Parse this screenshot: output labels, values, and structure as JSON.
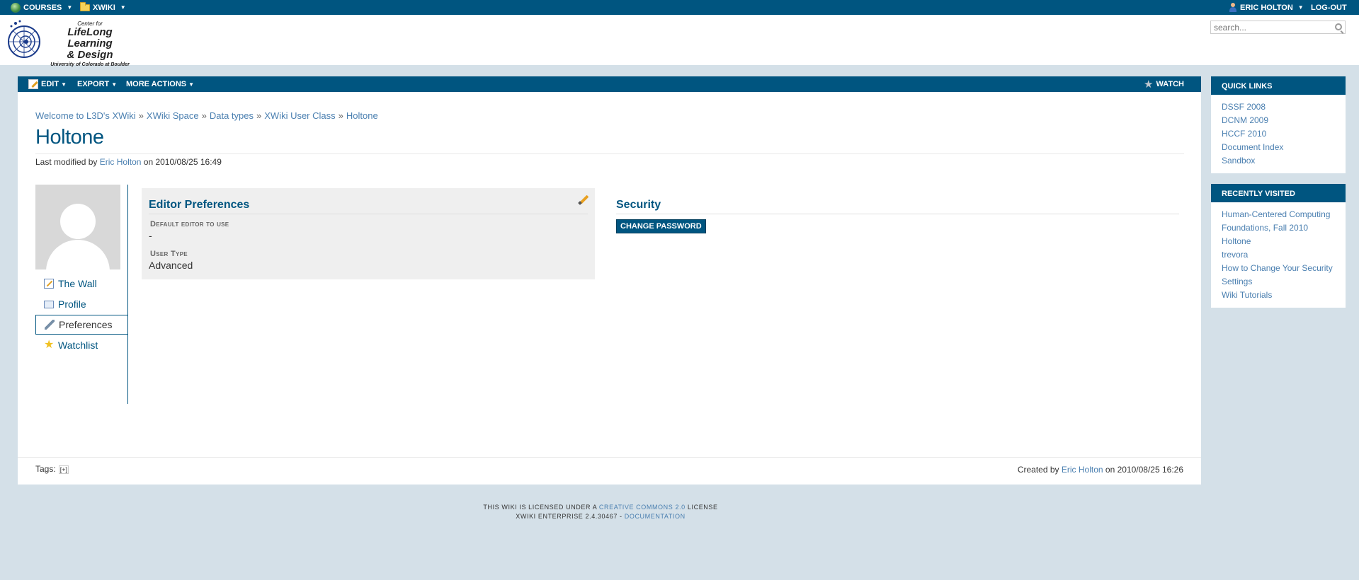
{
  "topbar": {
    "courses": "COURSES",
    "xwiki": "XWIKI",
    "user": "ERIC HOLTON",
    "logout": "LOG-OUT"
  },
  "logo": {
    "center": "Center for",
    "line1": "LifeLong Learning",
    "line2": "& Design",
    "univ": "University of Colorado at Boulder"
  },
  "search": {
    "placeholder": "search..."
  },
  "menubar": {
    "edit": "EDIT",
    "export": "EXPORT",
    "more_actions": "MORE ACTIONS",
    "watch": "WATCH"
  },
  "breadcrumb": [
    "Welcome to L3D's XWiki",
    "XWiki Space",
    "Data types",
    "XWiki User Class",
    "Holtone"
  ],
  "page": {
    "title": "Holtone",
    "last_modified_prefix": "Last modified by",
    "last_modified_user": "Eric Holton",
    "last_modified_suffix": "on 2010/08/25 16:49"
  },
  "profile_menu": {
    "wall": "The Wall",
    "profile": "Profile",
    "preferences": "Preferences",
    "watchlist": "Watchlist"
  },
  "editor_prefs": {
    "title": "Editor Preferences",
    "default_editor_label": "Default editor to use",
    "default_editor_value": "-",
    "user_type_label": "User Type",
    "user_type_value": "Advanced"
  },
  "security": {
    "title": "Security",
    "change_password": "CHANGE PASSWORD"
  },
  "footer": {
    "tags_label": "Tags:",
    "tags_add": "[+]",
    "created_prefix": "Created by",
    "created_user": "Eric Holton",
    "created_suffix": "on 2010/08/25 16:26"
  },
  "quick_links": {
    "title": "QUICK LINKS",
    "items": [
      "DSSF 2008",
      "DCNM 2009",
      "HCCF 2010",
      "Document Index",
      "Sandbox"
    ]
  },
  "recently_visited": {
    "title": "RECENTLY VISITED",
    "items": [
      "Human-Centered Computing",
      "Foundations, Fall 2010",
      "Holtone",
      "trevora",
      "How to Change Your Security",
      "Settings",
      "Wiki Tutorials"
    ]
  },
  "bottom": {
    "license_prefix": "THIS WIKI IS LICENSED UNDER A",
    "license_link": "CREATIVE COMMONS 2.0",
    "license_suffix": "LICENSE",
    "version": "XWIKI ENTERPRISE 2.4.30467 -",
    "documentation": "DOCUMENTATION"
  }
}
